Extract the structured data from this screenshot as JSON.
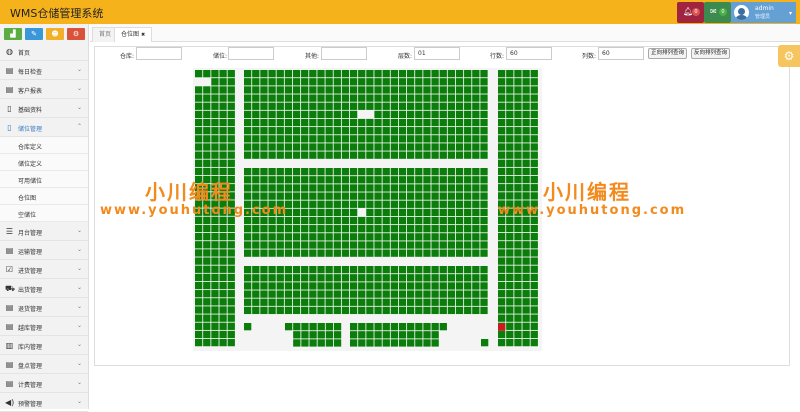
{
  "app": {
    "title": "WMS仓储管理系统"
  },
  "header": {
    "bell_badge": "0",
    "mail_badge": "0",
    "user_name": "admin",
    "user_role": "管理员",
    "colors": {
      "bar": "#f5b21a",
      "bell": "#a0233f",
      "mail": "#3c8a4e",
      "user": "#64a0d4"
    }
  },
  "sidebar": {
    "tool_buttons": [
      {
        "icon": "chart-icon",
        "color": "#5bac42"
      },
      {
        "icon": "pencil-icon",
        "color": "#3a98d8"
      },
      {
        "icon": "users-icon",
        "color": "#f2b02a"
      },
      {
        "icon": "cogs-icon",
        "color": "#d9533b"
      }
    ],
    "items": [
      {
        "label": "首页",
        "icon": "dashboard-icon",
        "glyph": "◍"
      },
      {
        "label": "每日检查",
        "icon": "calendar-icon",
        "glyph": "▤",
        "chevron": "⌄"
      },
      {
        "label": "客户报表",
        "icon": "table-icon",
        "glyph": "▤",
        "chevron": "⌄"
      },
      {
        "label": "基础资料",
        "icon": "file-icon",
        "glyph": "▯",
        "chevron": "⌄"
      },
      {
        "label": "储位管理",
        "icon": "mobile-icon",
        "glyph": "▯",
        "chevron": "⌃",
        "active": true,
        "children": [
          "仓库定义",
          "储位定义",
          "可用储位",
          "仓位图",
          "空储位"
        ]
      },
      {
        "label": "月台管理",
        "icon": "list-icon",
        "glyph": "☰",
        "chevron": "⌄"
      },
      {
        "label": "运输管理",
        "icon": "truck-list-icon",
        "glyph": "▤",
        "chevron": "⌄"
      },
      {
        "label": "进货管理",
        "icon": "checkbox-icon",
        "glyph": "☑",
        "chevron": "⌄"
      },
      {
        "label": "出货管理",
        "icon": "truck-icon",
        "glyph": "⛟",
        "chevron": "⌄"
      },
      {
        "label": "退货管理",
        "icon": "return-icon",
        "glyph": "▤",
        "chevron": "⌄"
      },
      {
        "label": "越库管理",
        "icon": "cross-dock-icon",
        "glyph": "▤",
        "chevron": "⌄"
      },
      {
        "label": "库内管理",
        "icon": "film-icon",
        "glyph": "▥",
        "chevron": "⌄"
      },
      {
        "label": "盘点管理",
        "icon": "inventory-icon",
        "glyph": "▤",
        "chevron": "⌄"
      },
      {
        "label": "计费管理",
        "icon": "billing-icon",
        "glyph": "▤",
        "chevron": "⌄"
      },
      {
        "label": "预警管理",
        "icon": "volume-icon",
        "glyph": "◀)",
        "chevron": "⌄"
      }
    ]
  },
  "tabs": [
    {
      "label": "首页",
      "active": false
    },
    {
      "label": "仓位图",
      "active": true,
      "close": "✖"
    }
  ],
  "filters": {
    "warehouse": {
      "label": "仓库:",
      "value": ""
    },
    "bin": {
      "label": "储位:",
      "value": ""
    },
    "other": {
      "label": "其他:",
      "value": ""
    },
    "layer": {
      "label": "层数:",
      "value": "01"
    },
    "rows": {
      "label": "行数:",
      "value": "60"
    },
    "cols": {
      "label": "列数:",
      "value": "60"
    },
    "btn_forward": "正向排列查询",
    "btn_reverse": "反向排列查询"
  },
  "grid": {
    "occupied_color": "#0a7d0a",
    "empty_color": "#ffffff",
    "alert_color": "#cc1a1a",
    "alert_count": 1
  },
  "watermark": {
    "line1": "小川编程",
    "line2": "www.youhutong.com",
    "color": "#f28a1e"
  }
}
